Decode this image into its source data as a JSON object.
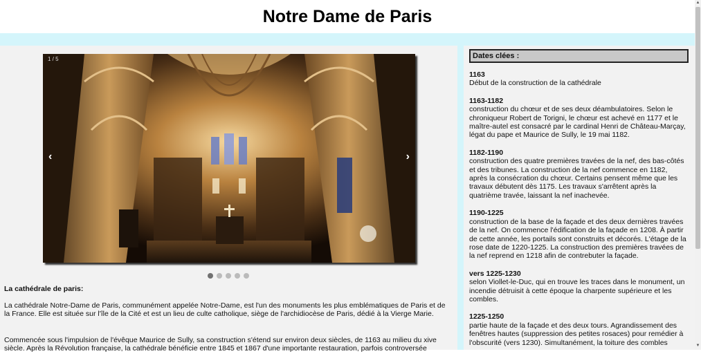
{
  "page": {
    "title": "Notre Dame de Paris"
  },
  "slider": {
    "counter": "1 / 5",
    "prev_glyph": "‹",
    "next_glyph": "›",
    "dot_count": 5,
    "active_dot": 1
  },
  "article": {
    "heading": "La cathédrale de paris:",
    "paragraph_1": "La cathédrale Notre-Dame de Paris, communément appelée Notre-Dame, est l'un des monuments les plus emblématiques de Paris et de la France. Elle est située sur l'île de la Cité et est un lieu de culte catholique, siège de l'archidiocèse de Paris, dédié à la Vierge Marie.",
    "paragraph_2": "Commencée sous l'impulsion de l'évêque Maurice de Sully, sa construction s'étend sur environ deux siècles, de 1163 au milieu du xive siècle. Après la Révolution française, la cathédrale bénéficie entre 1845 et 1867 d'une importante restauration, parfois controversée"
  },
  "dates": {
    "title": "Dates clées :",
    "entries": [
      {
        "year": "1163",
        "text": "Début de la construction de la cathédrale"
      },
      {
        "year": "1163-1182",
        "text": "construction du chœur et de ses deux déambulatoires. Selon le chroniqueur Robert de Torigni, le chœur est achevé en 1177 et le maître-autel est consacré par le cardinal Henri de Château-Marçay, légat du pape et Maurice de Sully, le 19 mai 1182."
      },
      {
        "year": "1182-1190",
        "text": "construction des quatre premières travées de la nef, des bas-côtés et des tribunes. La construction de la nef commence en 1182, après la consécration du chœur. Certains pensent même que les travaux débutent dès 1175. Les travaux s'arrêtent après la quatrième travée, laissant la nef inachevée."
      },
      {
        "year": "1190-1225",
        "text": "construction de la base de la façade et des deux dernières travées de la nef. On commence l'édification de la façade en 1208. À partir de cette année, les portails sont construits et décorés. L'étage de la rose date de 1220-1225. La construction des premières travées de la nef reprend en 1218 afin de contrebuter la façade."
      },
      {
        "year": "vers 1225-1230",
        "text": "selon Viollet-le-Duc, qui en trouve les traces dans le monument, un incendie détruisit à cette époque la charpente supérieure et les combles."
      },
      {
        "year": "1225-1250",
        "text": "partie haute de la façade et des deux tours. Agrandissement des fenêtres hautes (suppression des petites rosaces) pour remédier à l'obscurité (vers 1230). Simultanément, la toiture des combles"
      }
    ]
  },
  "colors": {
    "band": "#d4f5fb",
    "panel": "#f2f2f2",
    "dates_title_bg": "#c8c8c8"
  }
}
